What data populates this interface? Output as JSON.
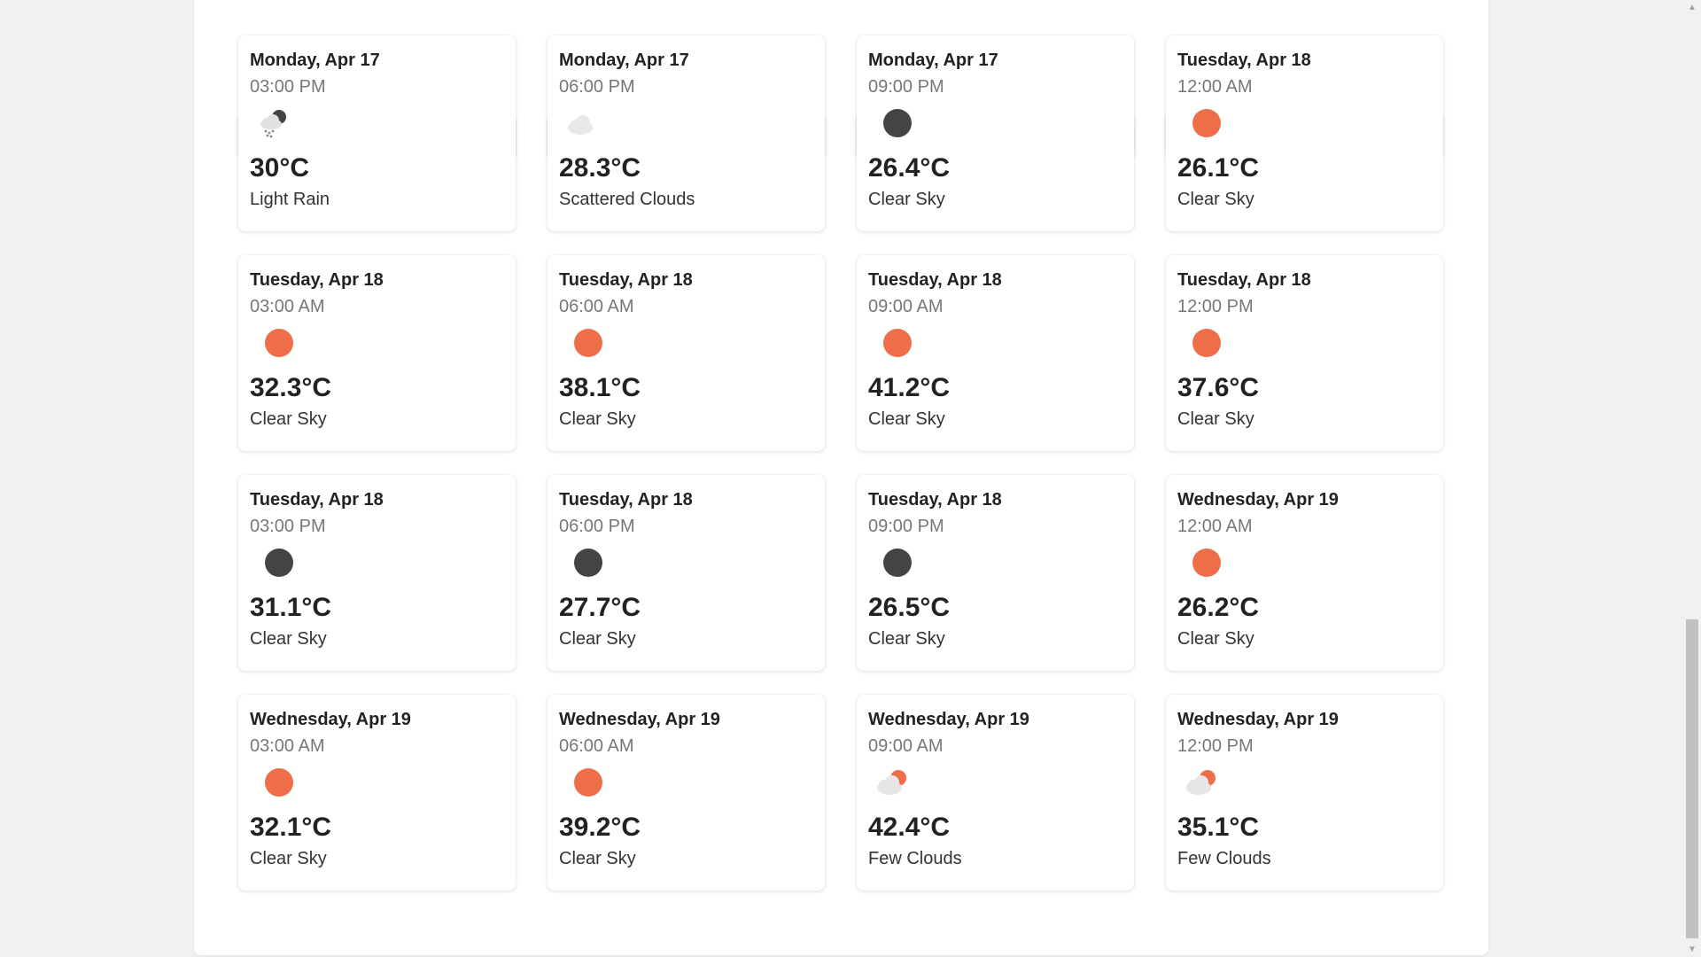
{
  "forecast": [
    {
      "date": "Monday, Apr 17",
      "time": "03:00 PM",
      "icon": "light-rain-icon",
      "temp": "30°C",
      "desc": "Light Rain"
    },
    {
      "date": "Monday, Apr 17",
      "time": "06:00 PM",
      "icon": "scattered-clouds-icon",
      "temp": "28.3°C",
      "desc": "Scattered Clouds"
    },
    {
      "date": "Monday, Apr 17",
      "time": "09:00 PM",
      "icon": "clear-night-icon",
      "temp": "26.4°C",
      "desc": "Clear Sky"
    },
    {
      "date": "Tuesday, Apr 18",
      "time": "12:00 AM",
      "icon": "clear-day-icon",
      "temp": "26.1°C",
      "desc": "Clear Sky"
    },
    {
      "date": "Tuesday, Apr 18",
      "time": "03:00 AM",
      "icon": "clear-day-icon",
      "temp": "32.3°C",
      "desc": "Clear Sky"
    },
    {
      "date": "Tuesday, Apr 18",
      "time": "06:00 AM",
      "icon": "clear-day-icon",
      "temp": "38.1°C",
      "desc": "Clear Sky"
    },
    {
      "date": "Tuesday, Apr 18",
      "time": "09:00 AM",
      "icon": "clear-day-icon",
      "temp": "41.2°C",
      "desc": "Clear Sky"
    },
    {
      "date": "Tuesday, Apr 18",
      "time": "12:00 PM",
      "icon": "clear-day-icon",
      "temp": "37.6°C",
      "desc": "Clear Sky"
    },
    {
      "date": "Tuesday, Apr 18",
      "time": "03:00 PM",
      "icon": "clear-night-icon",
      "temp": "31.1°C",
      "desc": "Clear Sky"
    },
    {
      "date": "Tuesday, Apr 18",
      "time": "06:00 PM",
      "icon": "clear-night-icon",
      "temp": "27.7°C",
      "desc": "Clear Sky"
    },
    {
      "date": "Tuesday, Apr 18",
      "time": "09:00 PM",
      "icon": "clear-night-icon",
      "temp": "26.5°C",
      "desc": "Clear Sky"
    },
    {
      "date": "Wednesday, Apr 19",
      "time": "12:00 AM",
      "icon": "clear-day-icon",
      "temp": "26.2°C",
      "desc": "Clear Sky"
    },
    {
      "date": "Wednesday, Apr 19",
      "time": "03:00 AM",
      "icon": "clear-day-icon",
      "temp": "32.1°C",
      "desc": "Clear Sky"
    },
    {
      "date": "Wednesday, Apr 19",
      "time": "06:00 AM",
      "icon": "clear-day-icon",
      "temp": "39.2°C",
      "desc": "Clear Sky"
    },
    {
      "date": "Wednesday, Apr 19",
      "time": "09:00 AM",
      "icon": "few-clouds-icon",
      "temp": "42.4°C",
      "desc": "Few Clouds"
    },
    {
      "date": "Wednesday, Apr 19",
      "time": "12:00 PM",
      "icon": "few-clouds-icon",
      "temp": "35.1°C",
      "desc": "Few Clouds"
    }
  ],
  "colors": {
    "sun": "#ee6e4a",
    "moon": "#444444",
    "cloud": "#e6e6e6",
    "background": "#f1f1f1",
    "card": "#ffffff"
  }
}
